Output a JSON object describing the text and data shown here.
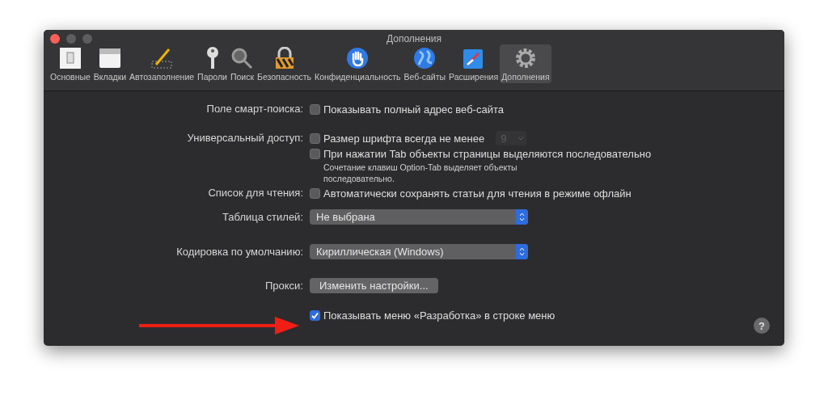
{
  "window": {
    "title": "Дополнения"
  },
  "toolbar": [
    {
      "label": "Основные",
      "selected": false
    },
    {
      "label": "Вкладки",
      "selected": false
    },
    {
      "label": "Автозаполнение",
      "selected": false
    },
    {
      "label": "Пароли",
      "selected": false
    },
    {
      "label": "Поиск",
      "selected": false
    },
    {
      "label": "Безопасность",
      "selected": false
    },
    {
      "label": "Конфиденциальность",
      "selected": false
    },
    {
      "label": "Веб-сайты",
      "selected": false
    },
    {
      "label": "Расширения",
      "selected": false
    },
    {
      "label": "Дополнения",
      "selected": true
    }
  ],
  "settings": [
    {
      "label": "Поле смарт-поиска:",
      "controls": [
        {
          "kind": "checkbox",
          "text": "Показывать полный адрес веб-сайта",
          "checked": false
        }
      ]
    },
    {
      "label": "Универсальный доступ:",
      "controls": [
        {
          "kind": "checkbox",
          "text": "Размер шрифта всегда не менее",
          "checked": false,
          "popup": {
            "value": "9",
            "disabled": true
          }
        },
        {
          "kind": "checkbox",
          "text": "При нажатии Tab объекты страницы выделяются последовательно",
          "checked": false
        },
        {
          "kind": "note",
          "text": "Сочетание клавиш Option-Tab выделяет объекты\nпоследовательно."
        }
      ]
    },
    {
      "label": "Список для чтения:",
      "controls": [
        {
          "kind": "checkbox",
          "text": "Автоматически сохранять статьи для чтения в режиме офлайн",
          "checked": false
        }
      ]
    },
    {
      "label": "Таблица стилей:",
      "controls": [
        {
          "kind": "select",
          "value": "Не выбрана"
        }
      ]
    },
    {
      "label": "Кодировка по умолчанию:",
      "controls": [
        {
          "kind": "select",
          "value": "Кириллическая (Windows)"
        }
      ]
    },
    {
      "label": "Прокси:",
      "controls": [
        {
          "kind": "button",
          "text": "Изменить настройки..."
        }
      ]
    },
    {
      "controls": [
        {
          "kind": "checkbox",
          "text": "Показывать меню «Разработка» в строке меню",
          "checked": true
        }
      ]
    }
  ],
  "help": "?"
}
